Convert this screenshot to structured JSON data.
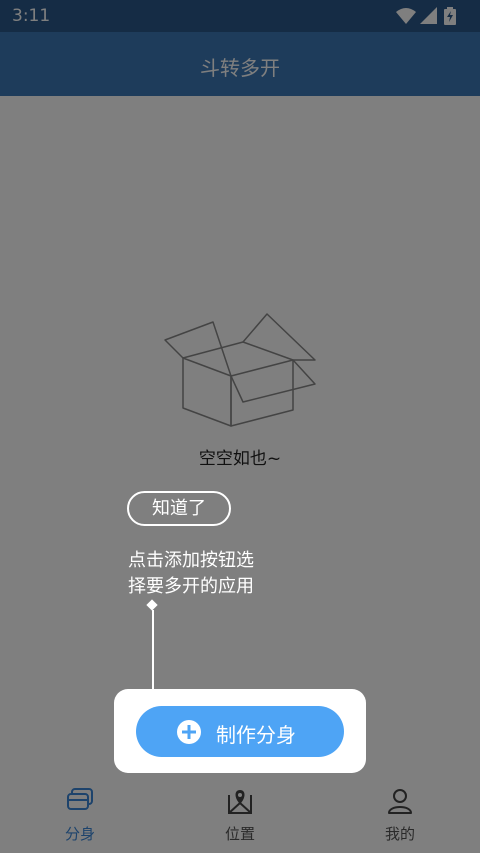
{
  "status_bar": {
    "time": "3:11",
    "icons": [
      "wifi-icon",
      "cellular-signal-icon",
      "battery-charging-icon"
    ]
  },
  "app_bar": {
    "title": "斗转多开"
  },
  "empty_state": {
    "icon": "empty-box-icon",
    "text": "空空如也~"
  },
  "guide": {
    "dismiss_label": "知道了",
    "hint_line1": "点击添加按钮选",
    "hint_line2": "择要多开的应用"
  },
  "action_button": {
    "icon": "plus-circle-icon",
    "label": "制作分身"
  },
  "bottom_nav": {
    "items": [
      {
        "icon": "clone-cards-icon",
        "label": "分身",
        "active": true
      },
      {
        "icon": "map-location-icon",
        "label": "位置",
        "active": false
      },
      {
        "icon": "person-icon",
        "label": "我的",
        "active": false
      }
    ]
  },
  "colors": {
    "status_bar": "#2a598a",
    "app_bar": "#3d79b7",
    "accent": "#4ea4f5",
    "nav_active": "#3b87d8",
    "overlay": "rgba(0,0,0,0.5)"
  }
}
